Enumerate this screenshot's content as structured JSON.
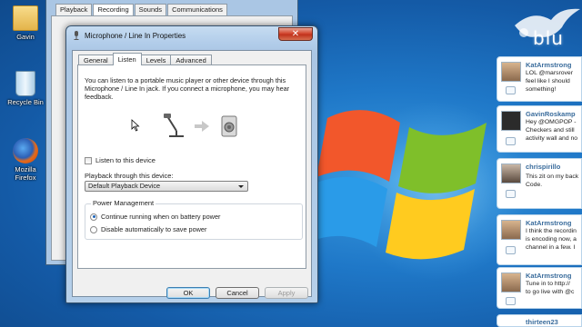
{
  "desktop": {
    "icons": [
      {
        "label": "Gavin",
        "icon": "folder-icon"
      },
      {
        "label": "Recycle Bin",
        "icon": "recycle-bin-icon"
      },
      {
        "label": "Mozilla Firefox",
        "icon": "firefox-icon"
      }
    ]
  },
  "sound_window": {
    "tabs": [
      "Playback",
      "Recording",
      "Sounds",
      "Communications"
    ],
    "active_tab": "Recording"
  },
  "dialog": {
    "title": "Microphone / Line In Properties",
    "close_label": "✕",
    "tabs": [
      "General",
      "Listen",
      "Levels",
      "Advanced"
    ],
    "active_tab": "Listen",
    "description": "You can listen to a portable music player or other device through this Microphone / Line In jack.  If you connect a microphone, you may hear feedback.",
    "listen_checkbox": {
      "label": "Listen to this device",
      "checked": false
    },
    "playback_label": "Playback through this device:",
    "playback_select": {
      "value": "Default Playback Device"
    },
    "power": {
      "title": "Power Management",
      "options": [
        {
          "label": "Continue running when on battery power",
          "selected": true
        },
        {
          "label": "Disable automatically to save power",
          "selected": false
        }
      ]
    },
    "buttons": {
      "ok": "OK",
      "cancel": "Cancel",
      "apply": "Apply"
    }
  },
  "blu": {
    "logo": "blu",
    "tweets": [
      {
        "user": "KatArmstrong",
        "lines": [
          "LOL @marsrover",
          "feel like I should",
          "something!"
        ]
      },
      {
        "user": "GavinRoskamp",
        "lines": [
          "Hey @OMGPOP -",
          "Checkers and still",
          "activity wall and no"
        ]
      },
      {
        "user": "chrispirillo",
        "lines": [
          "This zit on my back",
          "Code."
        ]
      },
      {
        "user": "KatArmstrong",
        "lines": [
          "I think the recordin",
          "is encoding now, a",
          "channel in a few. I"
        ]
      },
      {
        "user": "KatArmstrong",
        "lines": [
          "Tune in to http://",
          "to go live with @c"
        ]
      },
      {
        "user": "thirteen23",
        "lines": []
      }
    ]
  },
  "colors": {
    "desktop_blue": "#1f78c8",
    "close_red": "#c0321c",
    "tweet_user": "#3a6c9c"
  }
}
